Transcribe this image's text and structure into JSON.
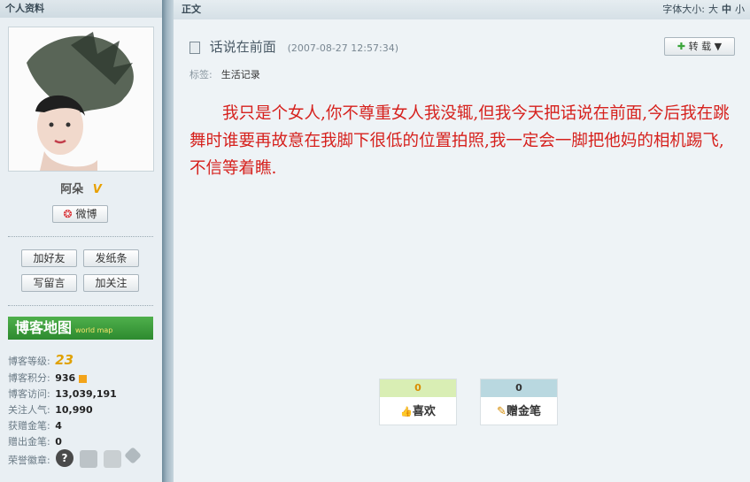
{
  "sidebar": {
    "header": "个人资料",
    "username": "阿朵",
    "weibo_label": "微博",
    "buttons": {
      "add_friend": "加好友",
      "send_note": "发纸条",
      "write_message": "写留言",
      "follow": "加关注"
    },
    "map_banner": {
      "title": "博客地图",
      "subtitle": "world map"
    },
    "stats": [
      {
        "label": "博客等级:",
        "value": "23"
      },
      {
        "label": "博客积分:",
        "value": "936"
      },
      {
        "label": "博客访问:",
        "value": "13,039,191"
      },
      {
        "label": "关注人气:",
        "value": "10,990"
      },
      {
        "label": "获赠金笔:",
        "value": "4"
      },
      {
        "label": "赠出金笔:",
        "value": "0"
      }
    ],
    "honor_label": "荣誉徽章:"
  },
  "main": {
    "header": "正文",
    "font_size": {
      "label": "字体大小:",
      "large": "大",
      "medium": "中",
      "small": "小"
    },
    "repost_label": "转 载",
    "post": {
      "title": "话说在前面",
      "date": "(2007-08-27 12:57:34)",
      "tag_label": "标签:",
      "tag_value": "生活记录",
      "body": "我只是个女人,你不尊重女人我没辄,但我今天把话说在前面,今后我在跳舞时谁要再故意在我脚下很低的位置拍照,我一定会一脚把他妈的相机踢飞,不信等着瞧."
    },
    "like": {
      "count": "0",
      "label": "喜欢"
    },
    "gift": {
      "count": "0",
      "label": "赠金笔"
    }
  },
  "colors": {
    "body_text": "#d6211d",
    "like_bar": "#d9eeb4",
    "gift_bar": "#b9d8e0"
  }
}
